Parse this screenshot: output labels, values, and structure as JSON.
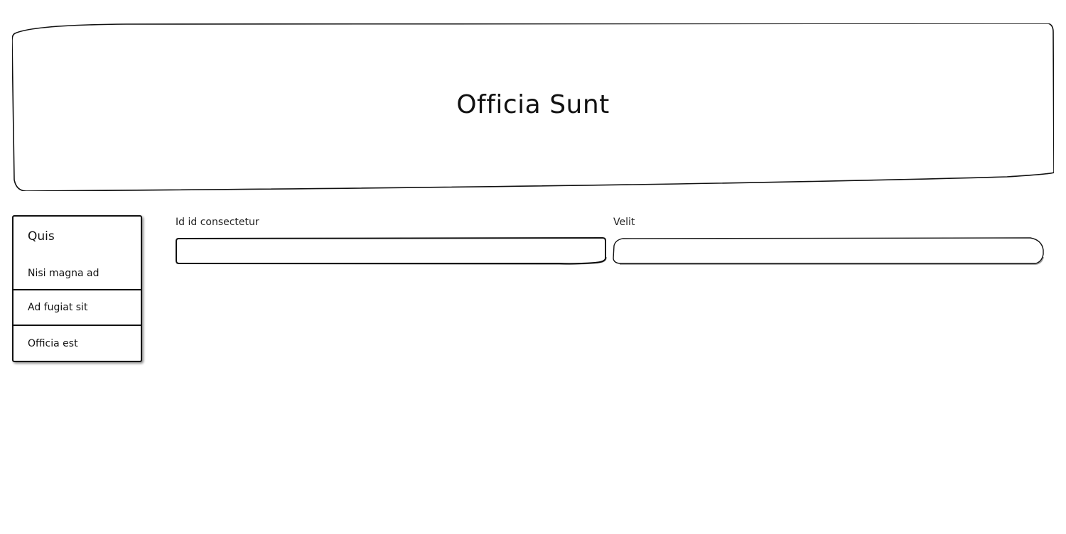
{
  "header": {
    "title": "Officia Sunt"
  },
  "sidebar": {
    "title": "Quis",
    "items": [
      {
        "label": "Nisi magna ad"
      },
      {
        "label": "Ad fugiat sit"
      },
      {
        "label": "Officia est"
      }
    ]
  },
  "form": {
    "field1": {
      "label": "Id id consectetur",
      "value": "",
      "placeholder": ""
    },
    "field2": {
      "label": "Velit",
      "value": "",
      "placeholder": ""
    }
  }
}
